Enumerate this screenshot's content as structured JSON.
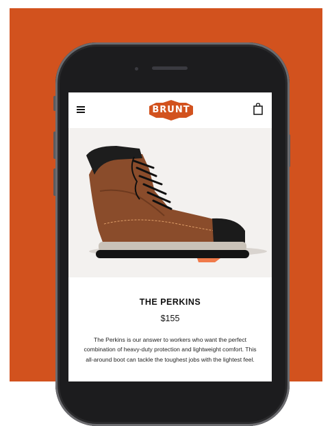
{
  "header": {
    "logo_text": "BRUNT",
    "menu_icon": "hamburger-menu-icon",
    "cart_icon": "shopping-bag-icon"
  },
  "product": {
    "name": "THE PERKINS",
    "price": "$155",
    "description": "The Perkins is our answer to workers who want the perfect combination of heavy-duty protection and lightweight comfort. This all-around boot can tackle the toughest jobs with the lightest feel."
  },
  "colors": {
    "brand_orange": "#d2521e",
    "phone_body": "#1c1c1e",
    "hero_background": "#f3f1ef",
    "boot_leather": "#8a4c2b"
  }
}
